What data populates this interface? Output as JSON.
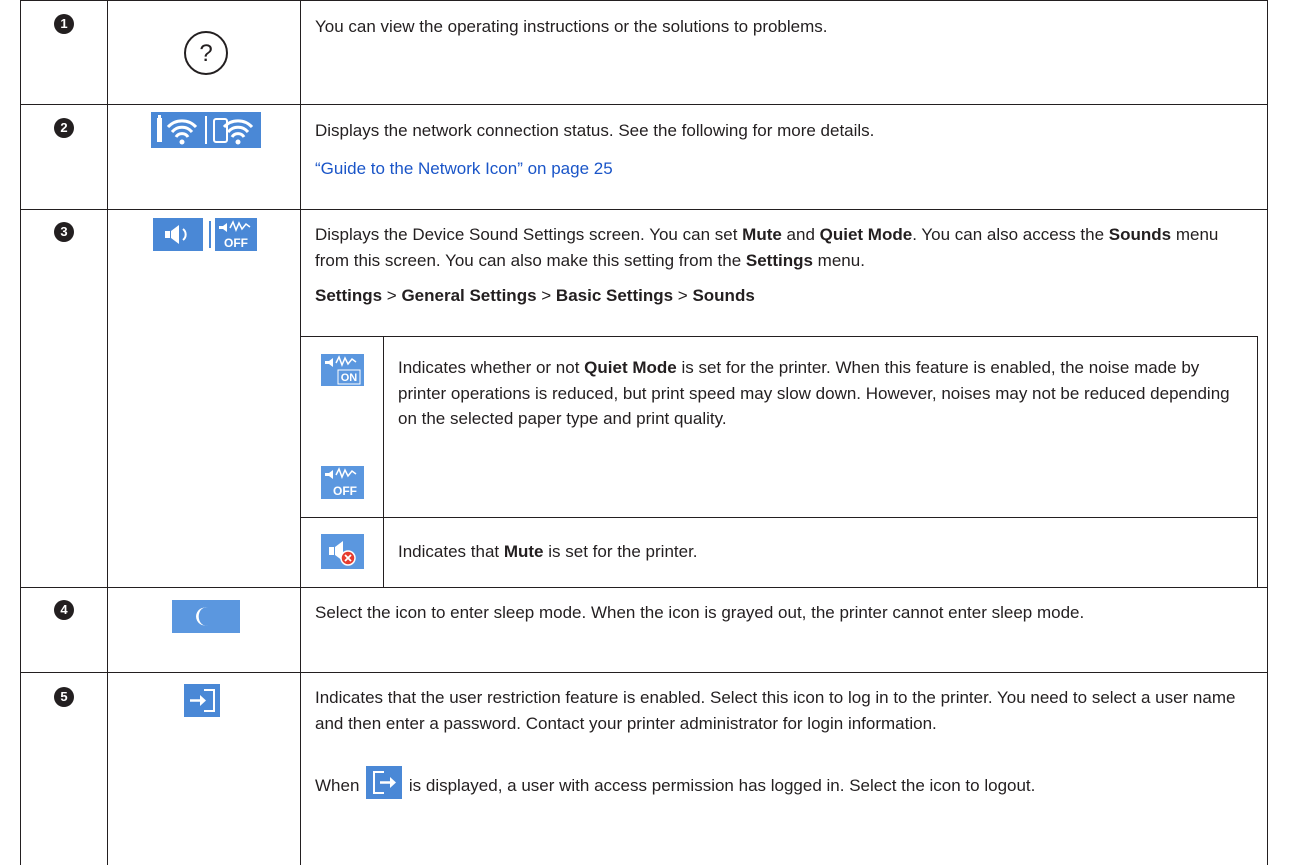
{
  "rows": [
    {
      "num": "1",
      "icon": "help-circle-icon",
      "text": "You can view the operating instructions or the solutions to problems."
    },
    {
      "num": "2",
      "icon": "network-status-icon",
      "text": "Displays the network connection status. See the following for more details.",
      "link": "“Guide to the Network Icon” on page 25"
    },
    {
      "num": "3",
      "icon": "sound-settings-icon",
      "text_parts": [
        "Displays the Device Sound Settings screen. You can set ",
        "Mute",
        " and ",
        "Quiet Mode",
        ". You can also access the ",
        "Sounds",
        " menu from this screen. You can also make this setting from the ",
        "Settings",
        " menu."
      ],
      "path": [
        "Settings",
        " > ",
        "General Settings",
        " > ",
        "Basic Settings",
        " > ",
        "Sounds"
      ],
      "sub_rows": [
        {
          "icons": [
            "quiet-mode-on-icon",
            "quiet-mode-off-icon"
          ],
          "on_label": "ON",
          "off_label": "OFF",
          "text_parts": [
            "Indicates whether or not ",
            "Quiet Mode",
            " is set for the printer. When this feature is enabled, the noise made by printer operations is reduced, but print speed may slow down. However, noises may not be reduced depending on the selected paper type and print quality."
          ]
        },
        {
          "icons": [
            "mute-icon"
          ],
          "text_parts": [
            "Indicates that ",
            "Mute",
            " is set for the printer."
          ]
        }
      ]
    },
    {
      "num": "4",
      "icon": "sleep-moon-icon",
      "text": "Select the icon to enter sleep mode. When the icon is grayed out, the printer cannot enter sleep mode."
    },
    {
      "num": "5",
      "icon": "login-icon",
      "text": "Indicates that the user restriction feature is enabled. Select this icon to log in to the printer. You need to select a user name and then enter a password. Contact your printer administrator for login information.",
      "logout_before": "When ",
      "logout_after": " is displayed, a user with access permission has logged in. Select the icon to logout."
    }
  ],
  "colors": {
    "icon_blue": "#4a88d6",
    "link": "#1a55c8",
    "text": "#231f20"
  }
}
